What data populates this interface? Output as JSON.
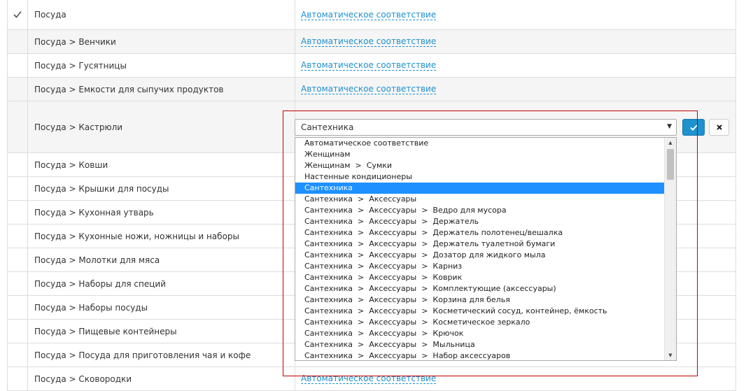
{
  "rows": [
    {
      "name": "Посуда",
      "mapping": "Автоматическое соответствие",
      "checked": true
    },
    {
      "name": "Посуда > Венчики",
      "mapping": "Автоматическое соответствие"
    },
    {
      "name": "Посуда > Гусятницы",
      "mapping": "Автоматическое соответствие"
    },
    {
      "name": "Посуда > Емкости для сыпучих продуктов",
      "mapping": "Автоматическое соответствие"
    },
    {
      "name": "Посуда > Кастрюли",
      "editing": true
    },
    {
      "name": "Посуда > Ковши"
    },
    {
      "name": "Посуда > Крышки для посуды"
    },
    {
      "name": "Посуда > Кухонная утварь"
    },
    {
      "name": "Посуда > Кухонные ножи, ножницы и наборы"
    },
    {
      "name": "Посуда > Молотки для мяса"
    },
    {
      "name": "Посуда > Наборы для специй"
    },
    {
      "name": "Посуда > Наборы посуды"
    },
    {
      "name": "Посуда > Пищевые контейнеры"
    },
    {
      "name": "Посуда > Посуда для приготовления чая и кофе"
    },
    {
      "name": "Посуда > Сковородки",
      "mapping": "Автоматическое соответствие"
    }
  ],
  "select": {
    "value": "Сантехника",
    "options": [
      "Автоматическое соответствие",
      "Женщинам",
      "Женщинам  >  Сумки",
      "Настенные кондиционеры",
      "Сантехника",
      "Сантехника  >  Аксессуары",
      "Сантехника  >  Аксессуары  >  Ведро для мусора",
      "Сантехника  >  Аксессуары  >  Держатель",
      "Сантехника  >  Аксессуары  >  Держатель полотенец/вешалка",
      "Сантехника  >  Аксессуары  >  Держатель туалетной бумаги",
      "Сантехника  >  Аксессуары  >  Дозатор для жидкого мыла",
      "Сантехника  >  Аксессуары  >  Карниз",
      "Сантехника  >  Аксессуары  >  Коврик",
      "Сантехника  >  Аксессуары  >  Комплектующие (аксессуары)",
      "Сантехника  >  Аксессуары  >  Корзина для белья",
      "Сантехника  >  Аксессуары  >  Косметический сосуд, контейнер, ёмкость",
      "Сантехника  >  Аксессуары  >  Косметическое зеркало",
      "Сантехника  >  Аксессуары  >  Крючок",
      "Сантехника  >  Аксессуары  >  Мыльница",
      "Сантехника  >  Аксессуары  >  Набор аксессуаров"
    ],
    "selected_index": 4
  },
  "colors": {
    "accent": "#1e91cf",
    "highlight": "#c00000",
    "selected": "#1e90ff"
  },
  "icons": {
    "ok": "check-icon",
    "cancel": "close-icon",
    "arrow": "chevron-down-icon"
  }
}
